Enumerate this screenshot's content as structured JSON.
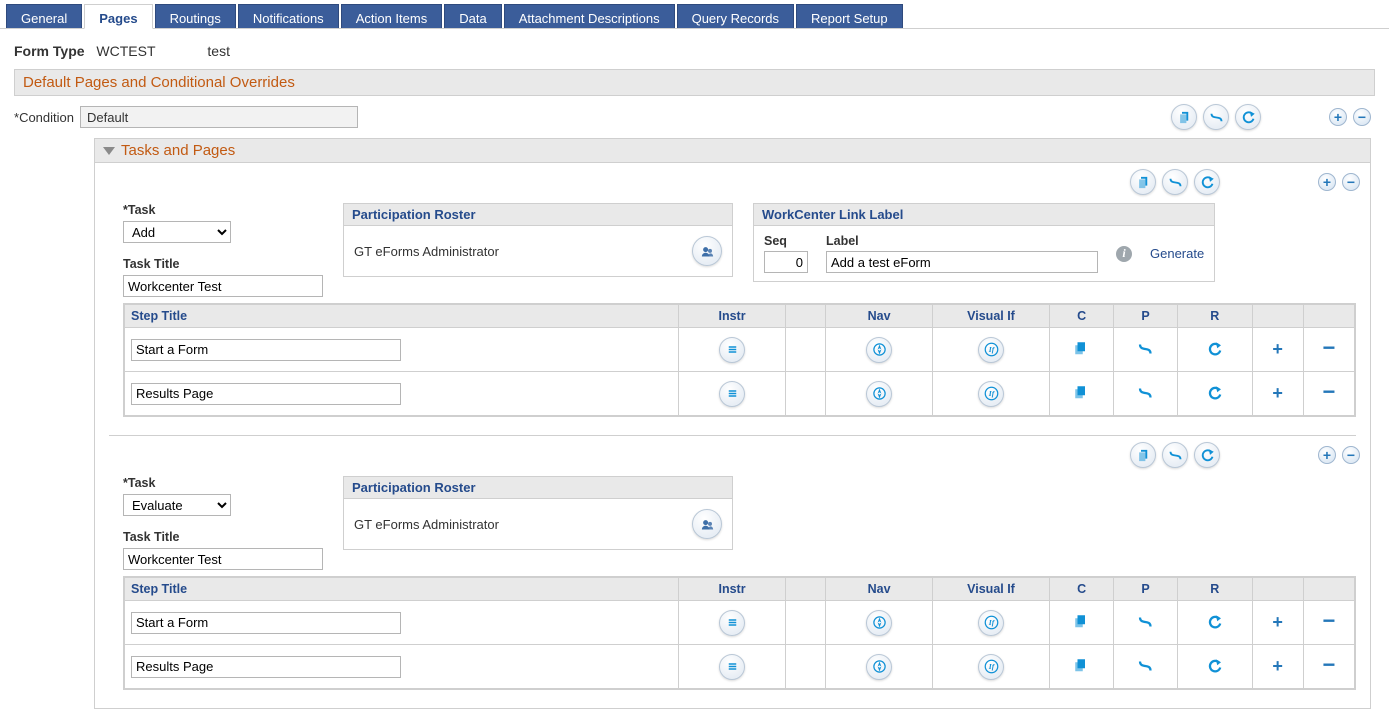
{
  "tabs": [
    "General",
    "Pages",
    "Routings",
    "Notifications",
    "Action Items",
    "Data",
    "Attachment Descriptions",
    "Query Records",
    "Report Setup"
  ],
  "active_tab_index": 1,
  "form_type_label": "Form Type",
  "form_type_code": "WCTEST",
  "form_type_desc": "test",
  "section_title": "Default Pages and Conditional Overrides",
  "condition_label": "Condition",
  "condition_value": "Default",
  "tasks_section_title": "Tasks and Pages",
  "labels": {
    "task": "Task",
    "task_title": "Task Title",
    "participation_roster": "Participation Roster",
    "workcenter_link_label": "WorkCenter Link Label",
    "seq": "Seq",
    "label": "Label",
    "generate": "Generate",
    "step_title": "Step Title",
    "instr": "Instr",
    "nav": "Nav",
    "visual_if": "Visual If",
    "c": "C",
    "p": "P",
    "r": "R"
  },
  "roster_text": "GT eForms Administrator",
  "tasks": [
    {
      "task": "Add",
      "task_title": "Workcenter Test",
      "has_workcenter": true,
      "workcenter": {
        "seq": 0,
        "label": "Add a test eForm"
      },
      "steps": [
        {
          "title": "Start a Form"
        },
        {
          "title": "Results Page"
        }
      ]
    },
    {
      "task": "Evaluate",
      "task_title": "Workcenter Test",
      "has_workcenter": false,
      "steps": [
        {
          "title": "Start a Form"
        },
        {
          "title": "Results Page"
        }
      ]
    }
  ]
}
